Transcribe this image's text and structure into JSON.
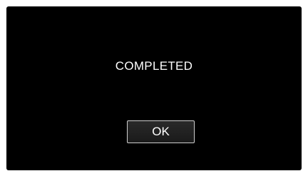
{
  "dialog": {
    "message": "COMPLETED",
    "ok_label": "OK"
  },
  "colors": {
    "screen_background": "#000000",
    "text": "#ffffff",
    "button_border": "#cfcfcf"
  }
}
